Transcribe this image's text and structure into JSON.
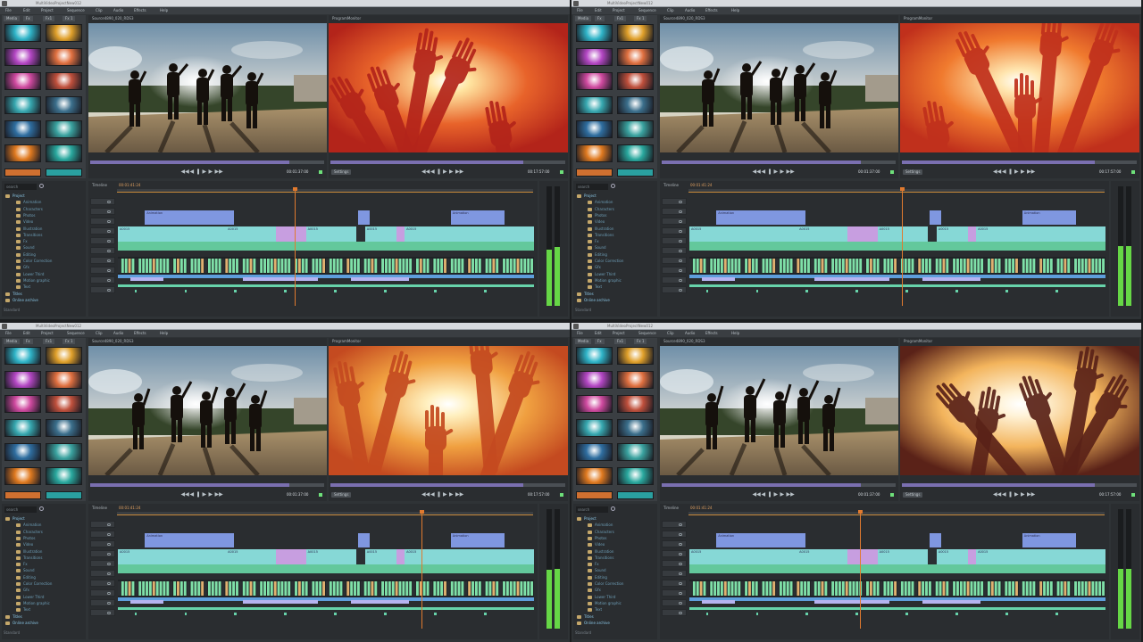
{
  "window_title": "MultiVideoProjectNew012",
  "menu": [
    "File",
    "Edit",
    "Project",
    "Sequence",
    "Clip",
    "Audio",
    "Effects",
    "Help"
  ],
  "media_tabs": [
    "Media",
    "Fx",
    "Fx1",
    "Fx 1"
  ],
  "source_label": "Source4890_020_RDS3",
  "program_label": "ProgramMonitor",
  "timeline_label": "Timeline",
  "settings_label": "Settings",
  "search_placeholder": "search",
  "status_text": "Standard",
  "project_tree": [
    {
      "label": "Project",
      "child": false
    },
    {
      "label": "Animation",
      "child": true
    },
    {
      "label": "Characters",
      "child": true
    },
    {
      "label": "Photos",
      "child": true
    },
    {
      "label": "Video",
      "child": true
    },
    {
      "label": "Illustration",
      "child": true
    },
    {
      "label": "Transitions",
      "child": true
    },
    {
      "label": "Fx",
      "child": true
    },
    {
      "label": "Sound",
      "child": true
    },
    {
      "label": "Editing",
      "child": true
    },
    {
      "label": "Color Correction",
      "child": true
    },
    {
      "label": "Gfx",
      "child": true
    },
    {
      "label": "Lower Third",
      "child": true
    },
    {
      "label": "Motion graphic",
      "child": true
    },
    {
      "label": "Text",
      "child": true
    },
    {
      "label": "Titles",
      "child": false
    },
    {
      "label": "Online archive",
      "child": false
    }
  ],
  "clip_labels": {
    "title": "Animation",
    "video": "A0015"
  },
  "quadrants": [
    {
      "source_tc": "00:01:37:00",
      "program_tc": "00:17:57:00",
      "tl_tc": "00:01:41:24",
      "playhead": 0.425,
      "meter_l": 0.47,
      "meter_r": 0.49,
      "scrub_src": 0.85,
      "scrub_prg": 0.82,
      "program_scene": "hands-a"
    },
    {
      "source_tc": "00:01:37:00",
      "program_tc": "00:17:57:00",
      "tl_tc": "00:01:41:24",
      "playhead": 0.51,
      "meter_l": 0.5,
      "meter_r": 0.5,
      "scrub_src": 0.85,
      "scrub_prg": 0.82,
      "program_scene": "hands-b"
    },
    {
      "source_tc": "00:01:37:00",
      "program_tc": "00:17:57:00",
      "tl_tc": "00:01:41:24",
      "playhead": 0.73,
      "meter_l": 0.49,
      "meter_r": 0.5,
      "scrub_src": 0.85,
      "scrub_prg": 0.82,
      "program_scene": "hands-c"
    },
    {
      "source_tc": "00:01:37:00",
      "program_tc": "00:17:57:00",
      "tl_tc": "00:01:41:24",
      "playhead": 0.41,
      "meter_l": 0.5,
      "meter_r": 0.5,
      "scrub_src": 0.85,
      "scrub_prg": 0.82,
      "program_scene": "hands-d"
    }
  ],
  "thumb_colors": [
    [
      "#2fb4c8",
      "#e0a02a"
    ],
    [
      "#b447c4",
      "#e07040"
    ],
    [
      "#d04aa0",
      "#c0503c"
    ],
    [
      "#37a8b0",
      "#3b6f8c"
    ],
    [
      "#2f6ea0",
      "#3aa3a0"
    ],
    [
      "#e07a20",
      "#29a89e"
    ]
  ],
  "accent": "#e07a2f",
  "meter_color": "#66d646"
}
